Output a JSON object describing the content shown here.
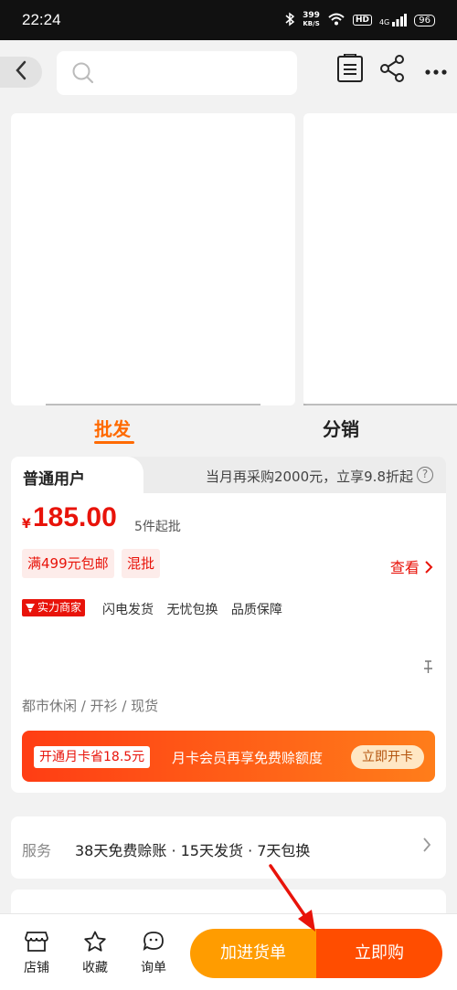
{
  "status_bar": {
    "time": "22:24",
    "speed_value": "399",
    "speed_unit": "KB/S",
    "hd": "HD",
    "network": "4G",
    "battery": "96"
  },
  "tabs": {
    "wholesale": "批发",
    "distribution": "分销"
  },
  "price_card": {
    "user_type": "普通用户",
    "promo": "当月再采购2000元，立享9.8折起",
    "currency_symbol": "¥",
    "price": "185.00",
    "min_order": "5件起批",
    "tags": [
      "满499元包邮",
      "混批"
    ],
    "view_label": "查看",
    "seller_badge": "实力商家",
    "service_tags": [
      "闪电发货",
      "无忧包换",
      "品质保障"
    ],
    "category": "都市休闲 / 开衫 / 现货",
    "member": {
      "pill": "开通月卡省18.5元",
      "text": "月卡会员再享免费赊额度",
      "button": "立即开卡"
    }
  },
  "service": {
    "label": "服务",
    "text": "38天免费赊账 · 15天发货 · 7天包换"
  },
  "bottom_bar": {
    "store": "店铺",
    "favorite": "收藏",
    "inquiry": "询单",
    "add_to_cart": "加进货单",
    "buy_now": "立即购"
  },
  "colors": {
    "accent_orange": "#ff6a00",
    "price_red": "#e8130a",
    "cart_button": "#ff9c00",
    "buy_button": "#ff4d00"
  }
}
